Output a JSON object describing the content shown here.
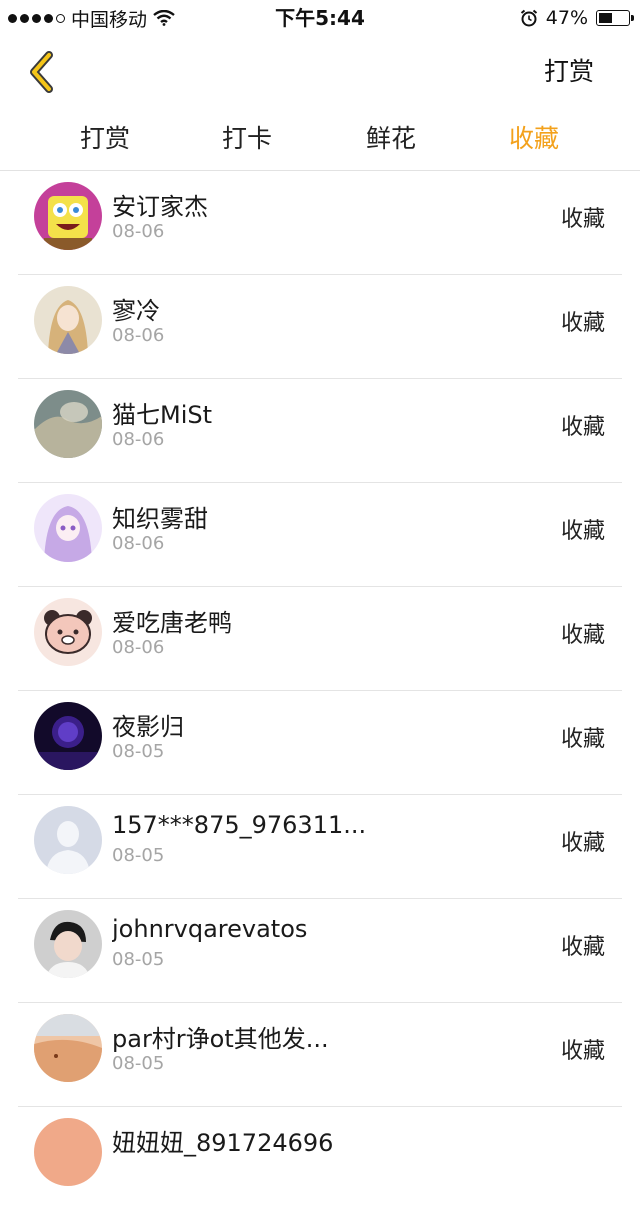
{
  "status_bar": {
    "carrier": "中国移动",
    "time": "下午5:44",
    "battery_text": "47%",
    "battery_level": 0.47,
    "signal_bars": 4
  },
  "nav": {
    "action_label": "打赏"
  },
  "tabs": [
    {
      "label": "打赏",
      "active": false
    },
    {
      "label": "打卡",
      "active": false
    },
    {
      "label": "鲜花",
      "active": false
    },
    {
      "label": "收藏",
      "active": true
    }
  ],
  "colors": {
    "accent": "#f3a11b",
    "back_icon": "#f5c518"
  },
  "items": [
    {
      "name": "安订家杰",
      "date": "08-06",
      "type": "收藏",
      "avatar": "spongebob-avatar",
      "avatar_bg": "#c4409a"
    },
    {
      "name": "寥冷",
      "date": "08-06",
      "type": "收藏",
      "avatar": "anime-girl-avatar",
      "avatar_bg": "#d8cdb8"
    },
    {
      "name": "猫七MiSt",
      "date": "08-06",
      "type": "收藏",
      "avatar": "landscape-avatar",
      "avatar_bg": "#8a9a96"
    },
    {
      "name": "知织雾甜",
      "date": "08-06",
      "type": "收藏",
      "avatar": "anime-purple-avatar",
      "avatar_bg": "#d9c8ef"
    },
    {
      "name": "爱吃唐老鸭",
      "date": "08-06",
      "type": "收藏",
      "avatar": "bear-avatar",
      "avatar_bg": "#f3d7cf"
    },
    {
      "name": "夜影归",
      "date": "08-05",
      "type": "收藏",
      "avatar": "night-sky-avatar",
      "avatar_bg": "#1b1038"
    },
    {
      "name": "157***875_976311...",
      "date": "08-05",
      "type": "收藏",
      "avatar": "default-user-avatar",
      "avatar_bg": "#d5dae6"
    },
    {
      "name": "johnrvqarevatos",
      "date": "08-05",
      "type": "收藏",
      "avatar": "person-avatar",
      "avatar_bg": "#c9c9c9"
    },
    {
      "name": "par村r诤ot其他发...",
      "date": "08-05",
      "type": "收藏",
      "avatar": "sunset-avatar",
      "avatar_bg": "#e6b08c"
    },
    {
      "name": "妞妞妞_891724696",
      "date": "",
      "type": "",
      "avatar": "peach-avatar",
      "avatar_bg": "#f0a989"
    }
  ]
}
